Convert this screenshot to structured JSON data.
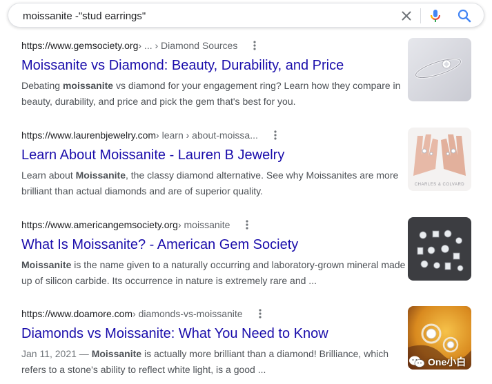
{
  "search": {
    "query": "moissanite -\"stud earrings\""
  },
  "icons": {
    "clear": "close-icon",
    "mic": "microphone-icon",
    "search": "search-icon",
    "more": "more-vert-icon"
  },
  "colors": {
    "link": "#1a0dab",
    "snippet": "#4d5156",
    "mic_blue": "#4285f4",
    "mic_red": "#ea4335",
    "mic_yellow": "#fbbc04",
    "mic_green": "#34a853"
  },
  "results": [
    {
      "domain": "https://www.gemsociety.org",
      "path": " › ... › Diamond Sources",
      "title": "Moissanite vs Diamond: Beauty, Durability, and Price",
      "snippet_pre": "Debating ",
      "snippet_bold": "moissanite",
      "snippet_post": " vs diamond for your engagement ring? Learn how they compare in beauty, durability, and price and pick the gem that's best for you."
    },
    {
      "domain": "https://www.laurenbjewelry.com",
      "path": " › learn › about-moissa...",
      "title": "Learn About Moissanite - Lauren B Jewelry",
      "snippet_pre": "Learn about ",
      "snippet_bold": "Moissanite",
      "snippet_post": ", the classy diamond alternative. See why Moissanites are more brilliant than actual diamonds and are of superior quality.",
      "thumb_caption": "CHARLES & COLVARD"
    },
    {
      "domain": "https://www.americangemsociety.org",
      "path": " › moissanite",
      "title": "What Is Moissanite? - American Gem Society",
      "snippet_bold": "Moissanite",
      "snippet_post": " is the name given to a naturally occurring and laboratory-grown mineral made up of silicon carbide. Its occurrence in nature is extremely rare and ..."
    },
    {
      "domain": "https://www.doamore.com",
      "path": " › diamonds-vs-moissanite",
      "title": "Diamonds vs Moissanite: What You Need to Know",
      "date": "Jan 11, 2021 — ",
      "snippet_bold": "Moissanite",
      "snippet_post": " is actually more brilliant than a diamond! Brilliance, which refers to a stone's ability to reflect white light, is a good ..."
    }
  ],
  "watermark": {
    "text": "One小白"
  }
}
